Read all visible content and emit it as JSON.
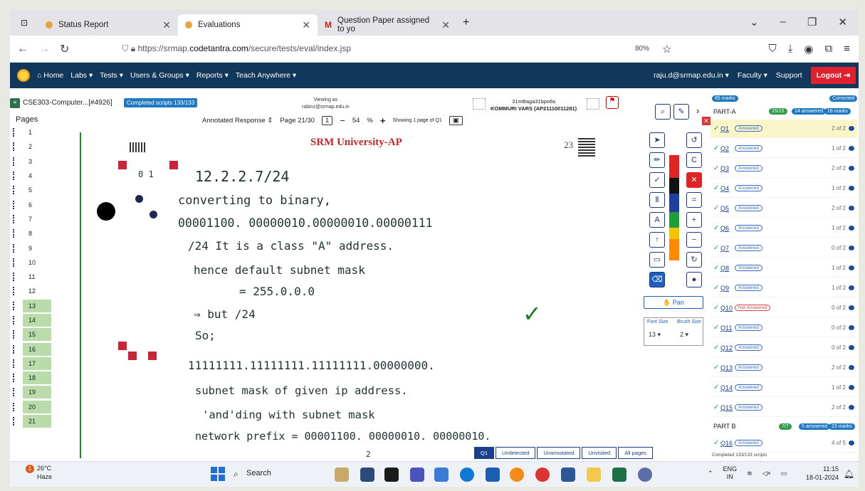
{
  "browser": {
    "tabs": [
      {
        "label": "Status Report",
        "active": false
      },
      {
        "label": "Evaluations",
        "active": true
      },
      {
        "label": "Question Paper assigned to yo",
        "active": false
      }
    ],
    "new_tab": "+",
    "url_prefix": "https://srmap.",
    "url_domain": "codetantra.com",
    "url_path": "/secure/tests/eval/index.jsp",
    "zoom": "80%"
  },
  "sitenav": {
    "items": [
      "Home",
      "Labs",
      "Tests",
      "Users & Groups",
      "Reports",
      "Teach Anywhere"
    ],
    "user": "raju.d@srmap.edu.in",
    "role": "Faculty",
    "support": "Support",
    "logout": "Logout"
  },
  "header": {
    "course": "CSE303-Computer...[#4926]",
    "scripts_badge": "Completed scripts 133/133",
    "viewing_label": "Viewing as",
    "viewing_email": "rabinz@srmap.edu.in",
    "student_id": "31mBaga31bpotla",
    "student_name": "KOMMURI VARS (AP21110011281)",
    "mode": "Annotated Response",
    "page": "Page 21/30",
    "page_index": "1",
    "zoom_value": "54",
    "zoom_unit": "%",
    "showing": "Showing 1 page of Q1",
    "pages_label": "Pages"
  },
  "pages": [
    "1",
    "2",
    "3",
    "4",
    "5",
    "6",
    "7",
    "8",
    "9",
    "10",
    "11",
    "12",
    "13",
    "14",
    "15",
    "16",
    "17",
    "18",
    "19",
    "20",
    "21"
  ],
  "sheet": {
    "university": "SRM University-AP",
    "page_no": "23",
    "roll": "0 1",
    "lines": [
      "12.2.2.7/24",
      "converting to binary,",
      "00001100. 00000010.00000010.00000111",
      "/24  It is a class \"A\" address.",
      "hence default subnet mask",
      "= 255.0.0.0",
      "⇒ but /24",
      "So;",
      "11111111.11111111.11111111.00000000.",
      "subnet mask of given ip address.",
      "'and'ding with subnet mask",
      "network prefix = 00001100. 00000010. 00000010."
    ],
    "tick": "✓",
    "footer_mark": "2"
  },
  "tools": {
    "pan_label": "Pan",
    "font_size_label": "Font Size",
    "font_size_value": "13",
    "brush_size_label": "Brush Size",
    "brush_size_value": "2",
    "colors": [
      "#e02424",
      "#111111",
      "#1d3f9e",
      "#1f9d3a",
      "#f5c400",
      "#ff8a00"
    ]
  },
  "panel": {
    "total_marks": "65 marks",
    "corrected": "Corrected",
    "partA": {
      "label": "PART-A",
      "count": "15/15",
      "answered": "14 answered",
      "marks": "16 marks"
    },
    "questions": [
      {
        "q": "Q1",
        "status": "Answered",
        "marks": "2 of 2"
      },
      {
        "q": "Q2",
        "status": "Answered",
        "marks": "1 of 2"
      },
      {
        "q": "Q3",
        "status": "Answered",
        "marks": "2 of 2"
      },
      {
        "q": "Q4",
        "status": "Answered",
        "marks": "1 of 2"
      },
      {
        "q": "Q5",
        "status": "Answered",
        "marks": "2 of 2"
      },
      {
        "q": "Q6",
        "status": "Answered",
        "marks": "1 of 2"
      },
      {
        "q": "Q7",
        "status": "Answered",
        "marks": "0 of 2"
      },
      {
        "q": "Q8",
        "status": "Answered",
        "marks": "1 of 2"
      },
      {
        "q": "Q9",
        "status": "Answered",
        "marks": "1 of 2"
      },
      {
        "q": "Q10",
        "status": "Not Answered",
        "marks": "0 of 2"
      },
      {
        "q": "Q11",
        "status": "Answered",
        "marks": "0 of 2"
      },
      {
        "q": "Q12",
        "status": "Answered",
        "marks": "0 of 2"
      },
      {
        "q": "Q13",
        "status": "Answered",
        "marks": "2 of 2"
      },
      {
        "q": "Q14",
        "status": "Answered",
        "marks": "1 of 2"
      },
      {
        "q": "Q15",
        "status": "Answered",
        "marks": "2 of 2"
      }
    ],
    "partB": {
      "label": "PART B",
      "count": "7/7",
      "answered": "5 answered",
      "marks": "23 marks"
    },
    "q16": {
      "q": "Q16",
      "status": "Answered",
      "marks": "4 of 5"
    },
    "completed": "Completed 133/133 scripts"
  },
  "bottom_tabs": [
    "Q1",
    "Undetected",
    "Unannotated",
    "Unvisited",
    "All pages"
  ],
  "taskbar": {
    "temp": "26°C",
    "weather": "Haze",
    "search": "Search",
    "lang": "ENG",
    "region": "IN",
    "time": "11:15",
    "date": "18-01-2024"
  }
}
